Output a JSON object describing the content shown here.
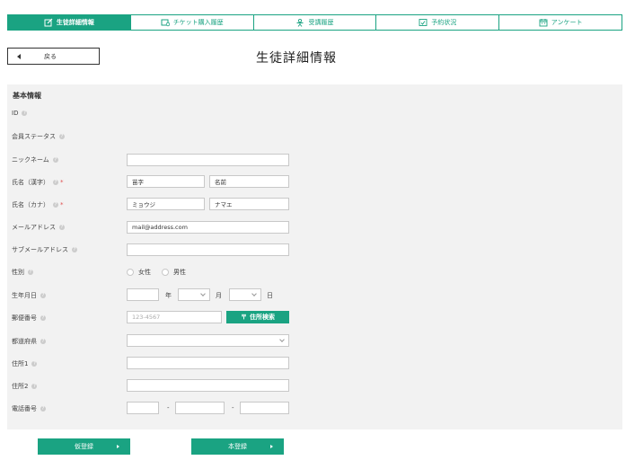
{
  "tabs": [
    {
      "label": "生徒詳細情報",
      "icon": "edit-icon",
      "active": true
    },
    {
      "label": "チケット購入履歴",
      "icon": "ticket-icon",
      "active": false
    },
    {
      "label": "受講履歴",
      "icon": "person-icon",
      "active": false
    },
    {
      "label": "予約状況",
      "icon": "calendar-check-icon",
      "active": false
    },
    {
      "label": "アンケート",
      "icon": "survey-icon",
      "active": false
    }
  ],
  "header": {
    "back_label": "戻る",
    "title": "生徒詳細情報"
  },
  "section": {
    "title": "基本情報"
  },
  "labels": {
    "id": "ID",
    "member_status": "会員ステータス",
    "nickname": "ニックネーム",
    "name_kanji": "氏名（漢字）",
    "name_kana": "氏名（カナ）",
    "email": "メールアドレス",
    "sub_email": "サブメールアドレス",
    "gender": "性別",
    "birthday": "生年月日",
    "zip": "郵便番号",
    "prefecture": "都道府県",
    "address1": "住所1",
    "address2": "住所2",
    "phone": "電話番号"
  },
  "help_mark": "?",
  "required_mark": "*",
  "fields": {
    "last_name": "苗字",
    "first_name": "名前",
    "last_name_kana": "ミョウジ",
    "first_name_kana": "ナマエ",
    "email": "mail@address.com",
    "zip_placeholder": "123-4567"
  },
  "gender_options": [
    "女性",
    "男性"
  ],
  "birthday_units": {
    "year": "年",
    "month": "月",
    "day": "日"
  },
  "phone_sep": "-",
  "zip_search_label": "住所検索",
  "buttons": {
    "temp_register": "仮登録",
    "register": "本登録"
  },
  "colors": {
    "accent": "#1aa382",
    "panel": "#f2f2f2",
    "required": "#e05050"
  }
}
